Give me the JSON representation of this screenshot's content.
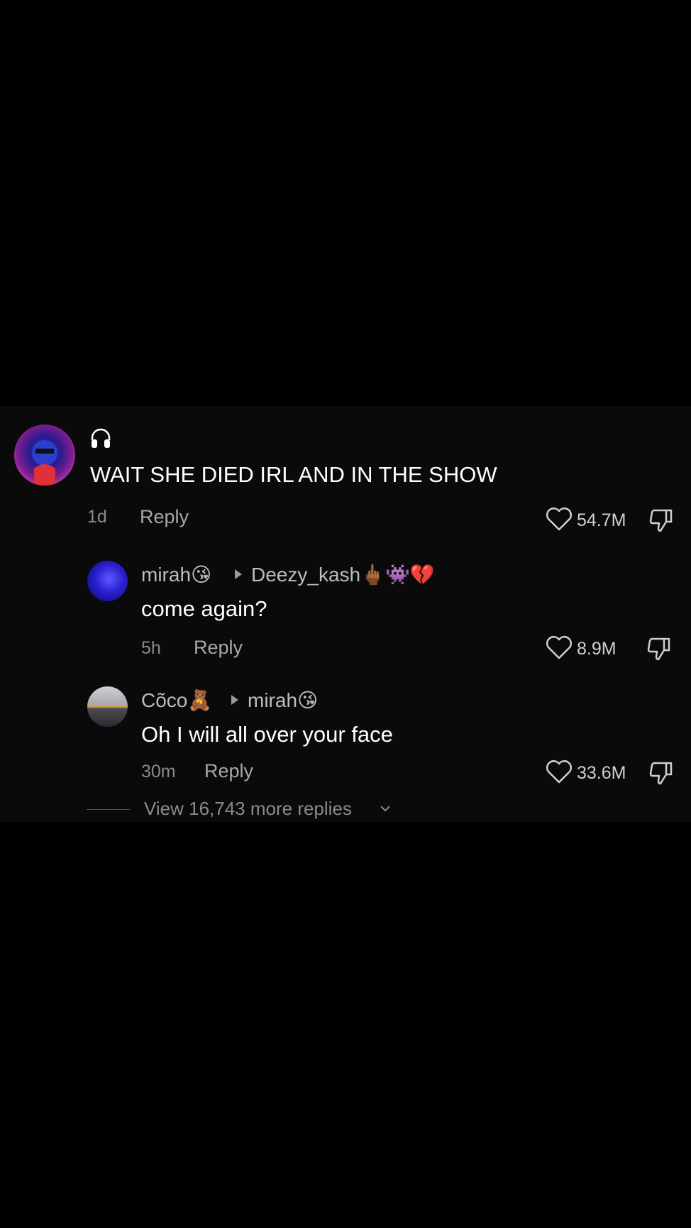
{
  "comments": [
    {
      "username": "",
      "text": "WAIT SHE DIED IRL AND IN THE SHOW",
      "time": "1d",
      "reply_label": "Reply",
      "likes": "54.7M",
      "badge_icon": "headphones-icon"
    },
    {
      "username": "mirah😘",
      "reply_to": "Deezy_kash🖕🏾👾💔",
      "text": "come again?",
      "time": "5h",
      "reply_label": "Reply",
      "likes": "8.9M"
    },
    {
      "username": "Cõco🧸",
      "reply_to": "mirah😘",
      "text": "Oh I will all over your face",
      "time": "30m",
      "reply_label": "Reply",
      "likes": "33.6M"
    }
  ],
  "view_more": "View 16,743 more replies",
  "colors": {
    "background": "#000000",
    "panel": "#0a0a0a",
    "text": "#ffffff",
    "muted": "#8a8a8a"
  }
}
